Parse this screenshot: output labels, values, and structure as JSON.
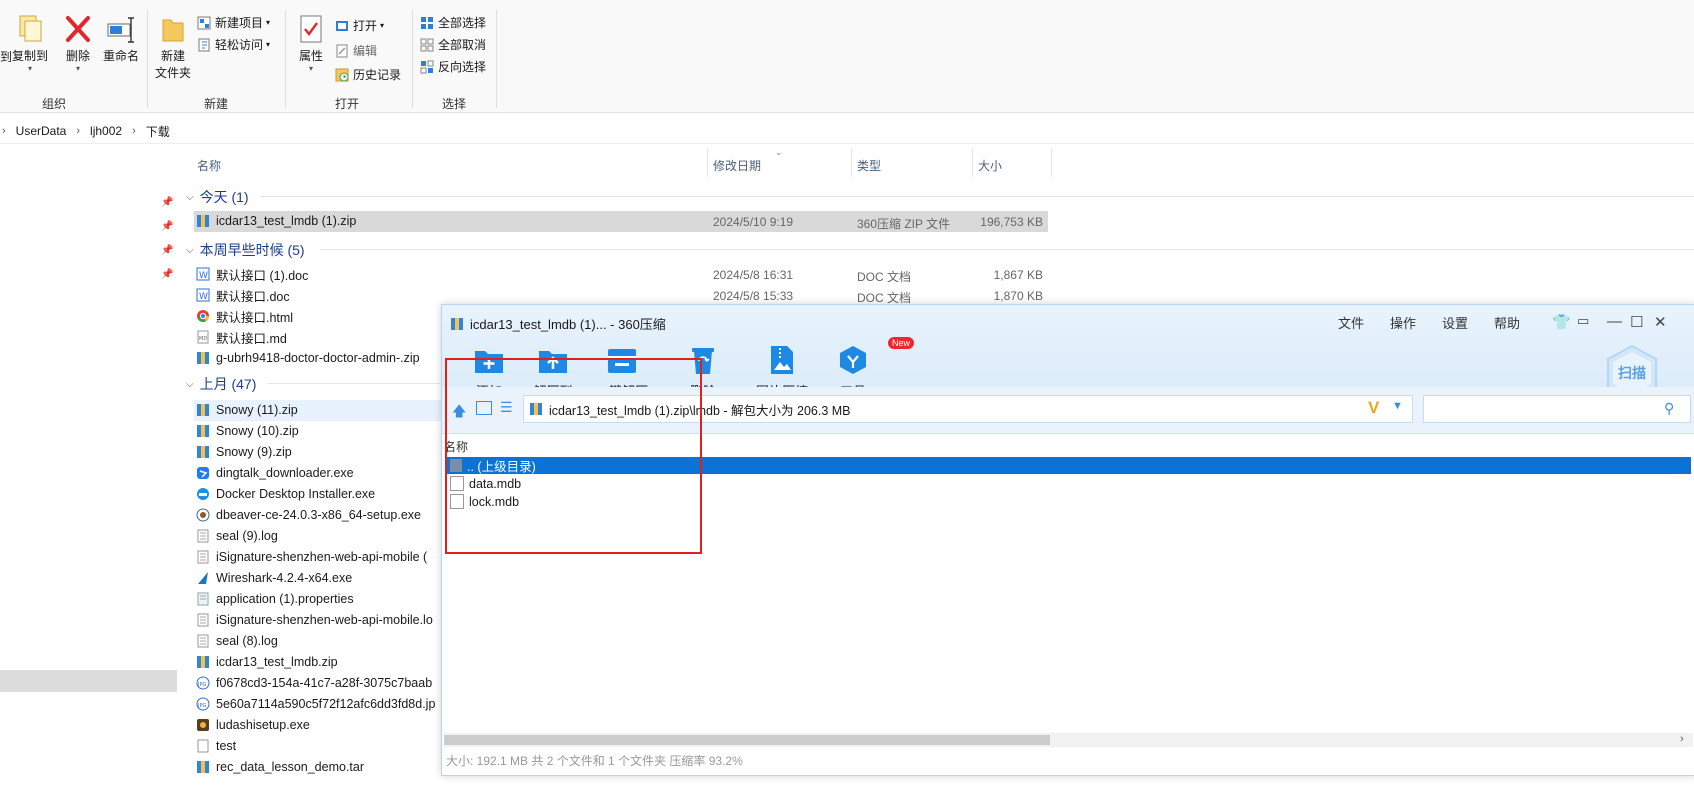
{
  "ribbon": {
    "organize": {
      "cut_fragment": "到",
      "copy_to": "复制到",
      "delete": "删除",
      "rename": "重命名",
      "group_label": "组织"
    },
    "new": {
      "new_folder_line1": "新建",
      "new_folder_line2": "文件夹",
      "new_item": "新建项目",
      "easy_access": "轻松访问",
      "group_label": "新建"
    },
    "open": {
      "properties": "属性",
      "open": "打开",
      "edit": "编辑",
      "history": "历史记录",
      "group_label": "打开"
    },
    "select": {
      "select_all": "全部选择",
      "select_none": "全部取消",
      "invert": "反向选择",
      "group_label": "选择"
    }
  },
  "breadcrumb": [
    "UserData",
    "ljh002",
    "下载"
  ],
  "columns": {
    "name": "名称",
    "modified": "修改日期",
    "type": "类型",
    "size": "大小"
  },
  "groups": {
    "today": "今天 (1)",
    "this_week": "本周早些时候 (5)",
    "last_month": "上月 (47)"
  },
  "files_today": [
    {
      "name": "icdar13_test_lmdb (1).zip",
      "date": "2024/5/10 9:19",
      "type": "360压缩 ZIP 文件",
      "size": "196,753 KB"
    }
  ],
  "files_week": [
    {
      "name": "默认接口 (1).doc",
      "date": "2024/5/8 16:31",
      "type": "DOC 文档",
      "size": "1,867 KB"
    },
    {
      "name": "默认接口.doc",
      "date": "2024/5/8 15:33",
      "type": "DOC 文档",
      "size": "1,870 KB"
    },
    {
      "name": "默认接口.html"
    },
    {
      "name": "默认接口.md"
    },
    {
      "name": "g-ubrh9418-doctor-doctor-admin-.zip"
    }
  ],
  "files_month": [
    {
      "name": "Snowy (11).zip"
    },
    {
      "name": "Snowy (10).zip"
    },
    {
      "name": "Snowy (9).zip"
    },
    {
      "name": "dingtalk_downloader.exe"
    },
    {
      "name": "Docker Desktop Installer.exe"
    },
    {
      "name": "dbeaver-ce-24.0.3-x86_64-setup.exe"
    },
    {
      "name": "seal (9).log"
    },
    {
      "name": "iSignature-shenzhen-web-api-mobile ("
    },
    {
      "name": "Wireshark-4.2.4-x64.exe"
    },
    {
      "name": "application (1).properties"
    },
    {
      "name": "iSignature-shenzhen-web-api-mobile.lo"
    },
    {
      "name": "seal (8).log"
    },
    {
      "name": "icdar13_test_lmdb.zip"
    },
    {
      "name": "f0678cd3-154a-41c7-a28f-3075c7baab"
    },
    {
      "name": "5e60a7114a590c5f72f12afc6dd3fd8d.jp"
    },
    {
      "name": "ludashisetup.exe"
    },
    {
      "name": "test"
    },
    {
      "name": "rec_data_lesson_demo.tar"
    }
  ],
  "zip_window": {
    "title": "icdar13_test_lmdb (1)... - 360压缩",
    "menu": [
      "文件",
      "操作",
      "设置",
      "帮助"
    ],
    "tools": {
      "add": "添加",
      "extract_to": "解压到",
      "one_click": "一键解压",
      "delete": "删除",
      "image_compress": "图片压缩",
      "tools": "工具",
      "new_badge": "New",
      "scan": "扫描"
    },
    "address": "icdar13_test_lmdb (1).zip\\lmdb - 解包大小为 206.3 MB",
    "list_header": "名称",
    "entries": [
      {
        "name": ".. (上级目录)"
      },
      {
        "name": "data.mdb"
      },
      {
        "name": "lock.mdb"
      }
    ],
    "status": "大小: 192.1 MB 共 2 个文件和 1 个文件夹 压缩率 93.2%"
  },
  "colors": {
    "accent": "#0a78d4",
    "selection_highlight": "#0b73d6",
    "group_heading": "#1e3e8c",
    "annotation_red": "#e0201b"
  }
}
